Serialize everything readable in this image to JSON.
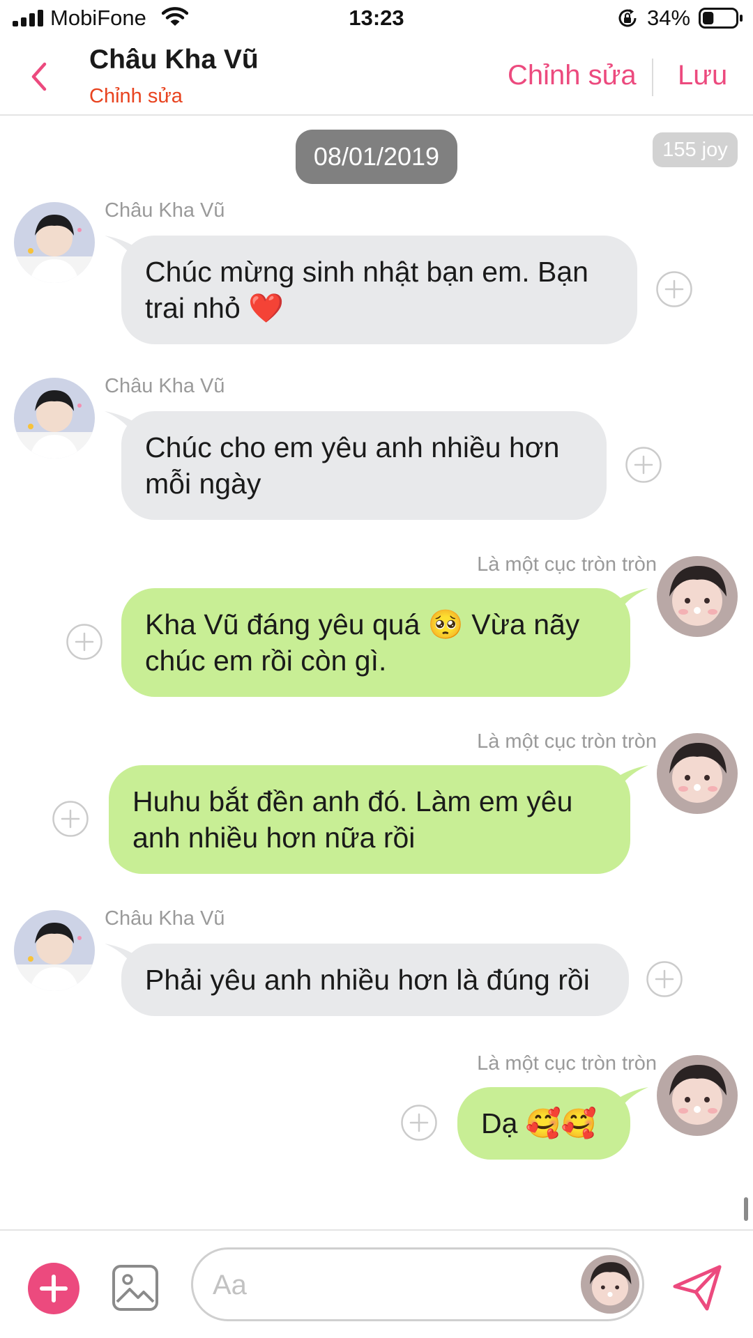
{
  "status_bar": {
    "carrier": "MobiFone",
    "time": "13:23",
    "battery_percent": "34%",
    "battery_level": 0.34
  },
  "header": {
    "contact_name": "Châu Kha Vũ",
    "subtitle": "Chỉnh sửa",
    "edit_label": "Chỉnh sửa",
    "save_label": "Lưu"
  },
  "chat": {
    "date": "08/01/2019",
    "joy_badge": "155 joy",
    "messages": [
      {
        "sender": "Châu Kha Vũ",
        "direction": "incoming",
        "lines": [
          "Chúc mừng sinh nhật bạn em. Bạn",
          "trai nhỏ ❤️"
        ]
      },
      {
        "sender": "Châu Kha Vũ",
        "direction": "incoming",
        "lines": [
          "Chúc cho em yêu anh nhiều hơn",
          "mỗi ngày"
        ]
      },
      {
        "sender": "Là một cục tròn tròn",
        "direction": "outgoing",
        "lines": [
          "Kha Vũ đáng yêu quá 🥺 Vừa nãy",
          "chúc em rồi còn gì."
        ]
      },
      {
        "sender": "Là một cục tròn tròn",
        "direction": "outgoing",
        "lines": [
          "Huhu bắt đền anh đó. Làm em yêu",
          "anh nhiều hơn nữa rồi"
        ]
      },
      {
        "sender": "Châu Kha Vũ",
        "direction": "incoming",
        "lines": [
          "Phải yêu anh nhiều hơn là đúng rồi"
        ]
      },
      {
        "sender": "Là một cục tròn tròn",
        "direction": "outgoing",
        "lines": [
          "Dạ 🥰🥰"
        ]
      }
    ]
  },
  "composer": {
    "placeholder": "Aa"
  },
  "icons": {
    "back": "chevron-left-icon",
    "add_reaction": "plus-circle-icon",
    "add": "plus-icon",
    "image": "image-icon",
    "send": "send-icon"
  },
  "colors": {
    "accent": "#ec4a7e",
    "subtitle": "#e8431f",
    "incoming_bubble": "#e8e9eb",
    "outgoing_bubble": "#c8ee95",
    "date_pill": "#808080"
  }
}
